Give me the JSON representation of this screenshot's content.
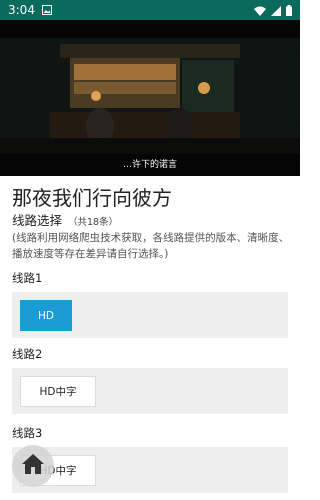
{
  "status_bar": {
    "time": "3:04",
    "left_icon": "image-icon",
    "right_icons": [
      "wifi-icon",
      "signal-icon",
      "battery-icon"
    ]
  },
  "video": {
    "subtitle": "…许下的诺言"
  },
  "header": {
    "title": "那夜我们行向彼方"
  },
  "routes": {
    "select_label": "线路选择",
    "count": "（共18条）",
    "note": "(线路利用网络爬虫技术获取，各线路提供的版本、清晰度、播放速度等存在差异请自行选择。)",
    "lines": [
      {
        "label": "线路1",
        "option": "HD",
        "active": true
      },
      {
        "label": "线路2",
        "option": "HD中字",
        "active": false
      },
      {
        "label": "线路3",
        "option": "HD中字",
        "active": false
      }
    ]
  },
  "fab": {
    "icon": "home-icon"
  },
  "colors": {
    "status_bar": "#0a6b5c",
    "accent": "#1a9bd6",
    "box": "#eeeeee"
  }
}
